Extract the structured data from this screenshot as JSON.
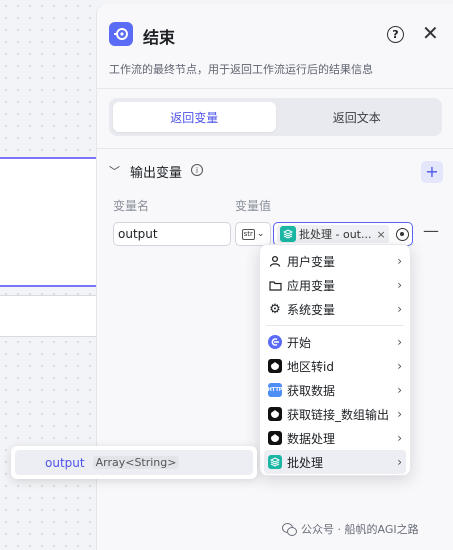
{
  "panel": {
    "title": "结束",
    "description": "工作流的最终节点，用于返回工作流运行后的结果信息",
    "help_glyph": "?",
    "close_glyph": "✕"
  },
  "tabs": [
    {
      "label": "返回变量",
      "active": true
    },
    {
      "label": "返回文本",
      "active": false
    }
  ],
  "output_section": {
    "title": "输出变量",
    "add_glyph": "+",
    "col_name": "变量名",
    "col_value": "变量值",
    "row": {
      "name": "output",
      "type_badge": "str",
      "ref_label": "批处理 - out...",
      "remove_glyph": "—"
    }
  },
  "dropdown": {
    "groups": [
      {
        "label": "用户变量",
        "icon": "user-icon"
      },
      {
        "label": "应用变量",
        "icon": "folder-icon"
      },
      {
        "label": "系统变量",
        "icon": "gear-icon"
      }
    ],
    "nodes": [
      {
        "label": "开始",
        "icon": "start-node-icon"
      },
      {
        "label": "地区转id",
        "icon": "plugin-icon"
      },
      {
        "label": "获取数据",
        "icon": "http-icon"
      },
      {
        "label": "获取链接_数组输出",
        "icon": "plugin-icon"
      },
      {
        "label": "数据处理",
        "icon": "plugin-icon"
      },
      {
        "label": "批处理",
        "icon": "batch-icon",
        "active": true
      }
    ],
    "http_text": "HTTP"
  },
  "popup": {
    "name": "output",
    "type": "Array<String>"
  },
  "watermark": {
    "text": "公众号 · 船帆的AGI之路"
  },
  "colors": {
    "accent": "#4d53e8",
    "teal": "#1bb6a4",
    "node_blue": "#5a6bf5"
  }
}
